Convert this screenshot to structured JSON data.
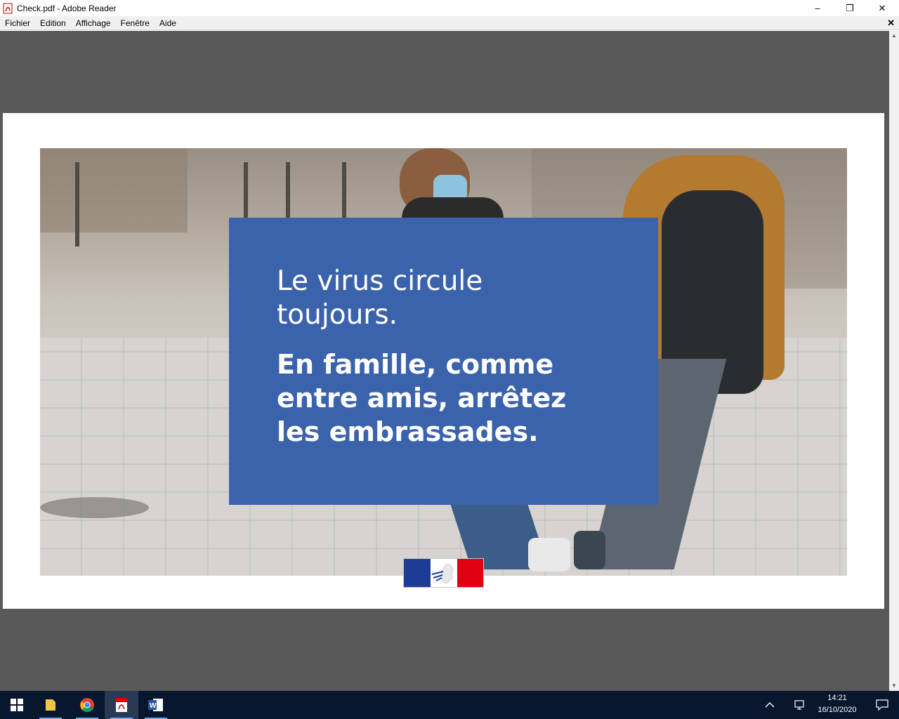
{
  "window": {
    "title": "Check.pdf - Adobe Reader",
    "controls": {
      "minimize": "–",
      "restore": "❐",
      "close": "✕"
    }
  },
  "menubar": {
    "items": [
      "Fichier",
      "Edition",
      "Affichage",
      "Fenêtre",
      "Aide"
    ],
    "doc_close": "✕"
  },
  "document": {
    "poster": {
      "line_light_1": "Le virus circule",
      "line_light_2": "toujours.",
      "line_bold_1": "En famille, comme",
      "line_bold_2": "entre amis, arrêtez",
      "line_bold_3": "les embrassades."
    },
    "colors": {
      "poster_blue": "#3b63ac",
      "flag_blue": "#1e3c96",
      "flag_red": "#e1000f"
    }
  },
  "taskbar": {
    "apps": [
      {
        "name": "start",
        "icon": "windows-start-icon"
      },
      {
        "name": "file-explorer",
        "icon": "folder-icon"
      },
      {
        "name": "chrome",
        "icon": "chrome-icon"
      },
      {
        "name": "adobe-reader",
        "icon": "pdf-icon",
        "active": true
      },
      {
        "name": "word",
        "icon": "word-icon"
      }
    ],
    "clock": {
      "time": "14:21",
      "date": "16/10/2020"
    }
  }
}
